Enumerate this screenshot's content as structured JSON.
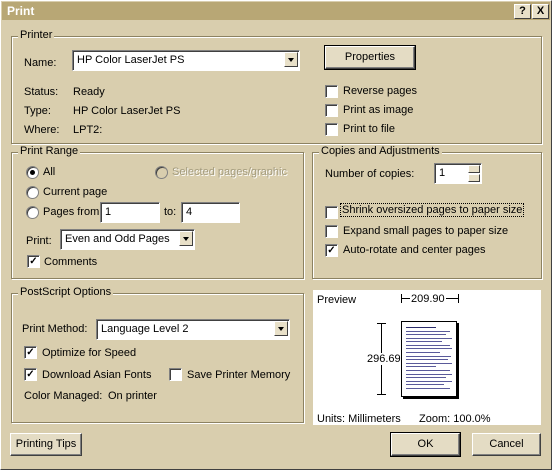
{
  "window": {
    "title": "Print",
    "help_btn": "?",
    "close_btn": "X"
  },
  "printer": {
    "group_title": "Printer",
    "name_label": "Name:",
    "name_value": "HP Color LaserJet PS",
    "properties_label": "Properties",
    "status_label": "Status:",
    "status_value": "Ready",
    "type_label": "Type:",
    "type_value": "HP Color LaserJet PS",
    "where_label": "Where:",
    "where_value": "LPT2:",
    "reverse_pages": "Reverse pages",
    "print_as_image": "Print as image",
    "print_to_file": "Print to file"
  },
  "print_range": {
    "group_title": "Print Range",
    "all_label": "All",
    "current_page_label": "Current page",
    "pages_from_label": "Pages from:",
    "from_value": "1",
    "to_label": "to:",
    "to_value": "4",
    "selected_label": "Selected pages/graphic",
    "print_label": "Print:",
    "print_value": "Even and Odd Pages",
    "comments_label": "Comments"
  },
  "copies": {
    "group_title": "Copies and Adjustments",
    "number_label": "Number of copies:",
    "number_value": "1",
    "shrink_label": "Shrink oversized pages to paper size",
    "expand_label": "Expand small pages to paper size",
    "autorotate_label": "Auto-rotate and center pages"
  },
  "postscript": {
    "group_title": "PostScript Options",
    "method_label": "Print Method:",
    "method_value": "Language Level 2",
    "optimize_label": "Optimize for Speed",
    "download_fonts_label": "Download Asian Fonts",
    "save_memory_label": "Save Printer Memory",
    "color_managed_label": "Color Managed:",
    "color_managed_value": "On printer"
  },
  "preview": {
    "title": "Preview",
    "width_value": "209.90",
    "height_value": "296.69",
    "units_label": "Units: Millimeters",
    "zoom_label": "Zoom: 100.0%"
  },
  "buttons": {
    "tips": "Printing Tips",
    "ok": "OK",
    "cancel": "Cancel"
  }
}
